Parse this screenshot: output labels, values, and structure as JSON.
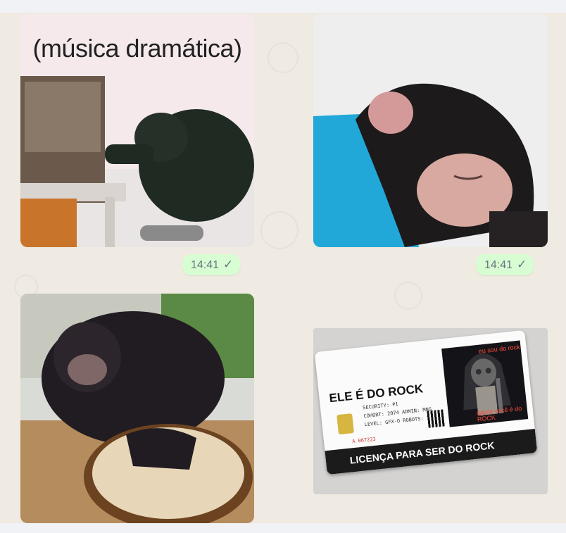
{
  "messages": [
    {
      "type": "sticker",
      "caption": "(música dramática)",
      "time": "14:41",
      "status": "check-icon"
    },
    {
      "type": "sticker",
      "caption": "",
      "time": "14:41",
      "status": "check-icon"
    },
    {
      "type": "sticker",
      "caption": "",
      "time": "",
      "status": ""
    },
    {
      "type": "sticker",
      "card": {
        "title": "ELE É DO ROCK",
        "security": "SECURITY: P1",
        "cohort": "COHORT: 2074  ADMIN: MNG",
        "level": "LEVEL: GFX-O  ROBOTS: 147",
        "id_code": "A 067223",
        "top_text": "eu sou do rock",
        "art_text": "agora você é do ROCK",
        "banner": "LICENÇA PARA SER DO ROCK"
      }
    }
  ],
  "colors": {
    "chat_bg": "#efeae2",
    "bubble": "#d9fdd3",
    "meta": "#667781"
  }
}
